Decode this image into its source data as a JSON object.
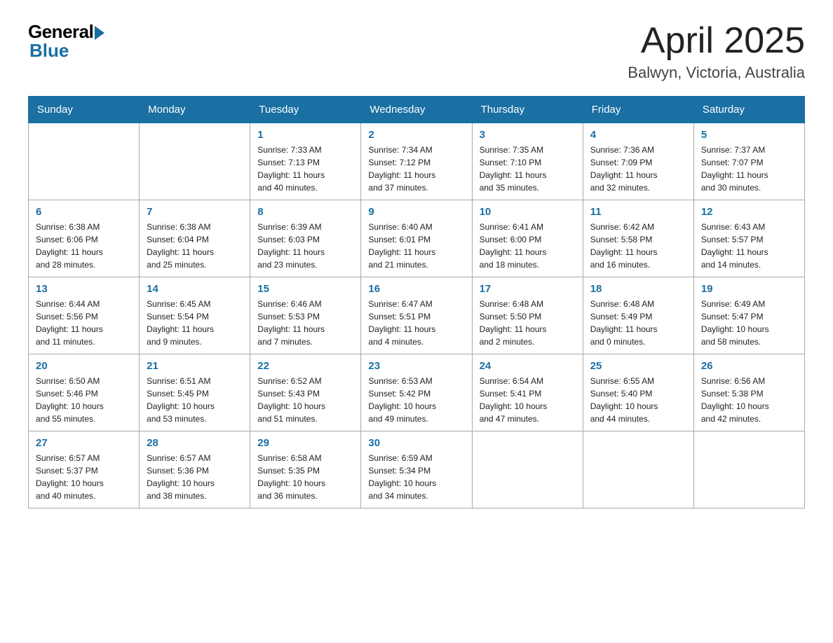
{
  "logo": {
    "general": "General",
    "blue": "Blue"
  },
  "title": "April 2025",
  "subtitle": "Balwyn, Victoria, Australia",
  "days": [
    "Sunday",
    "Monday",
    "Tuesday",
    "Wednesday",
    "Thursday",
    "Friday",
    "Saturday"
  ],
  "weeks": [
    [
      {
        "date": "",
        "info": ""
      },
      {
        "date": "",
        "info": ""
      },
      {
        "date": "1",
        "info": "Sunrise: 7:33 AM\nSunset: 7:13 PM\nDaylight: 11 hours\nand 40 minutes."
      },
      {
        "date": "2",
        "info": "Sunrise: 7:34 AM\nSunset: 7:12 PM\nDaylight: 11 hours\nand 37 minutes."
      },
      {
        "date": "3",
        "info": "Sunrise: 7:35 AM\nSunset: 7:10 PM\nDaylight: 11 hours\nand 35 minutes."
      },
      {
        "date": "4",
        "info": "Sunrise: 7:36 AM\nSunset: 7:09 PM\nDaylight: 11 hours\nand 32 minutes."
      },
      {
        "date": "5",
        "info": "Sunrise: 7:37 AM\nSunset: 7:07 PM\nDaylight: 11 hours\nand 30 minutes."
      }
    ],
    [
      {
        "date": "6",
        "info": "Sunrise: 6:38 AM\nSunset: 6:06 PM\nDaylight: 11 hours\nand 28 minutes."
      },
      {
        "date": "7",
        "info": "Sunrise: 6:38 AM\nSunset: 6:04 PM\nDaylight: 11 hours\nand 25 minutes."
      },
      {
        "date": "8",
        "info": "Sunrise: 6:39 AM\nSunset: 6:03 PM\nDaylight: 11 hours\nand 23 minutes."
      },
      {
        "date": "9",
        "info": "Sunrise: 6:40 AM\nSunset: 6:01 PM\nDaylight: 11 hours\nand 21 minutes."
      },
      {
        "date": "10",
        "info": "Sunrise: 6:41 AM\nSunset: 6:00 PM\nDaylight: 11 hours\nand 18 minutes."
      },
      {
        "date": "11",
        "info": "Sunrise: 6:42 AM\nSunset: 5:58 PM\nDaylight: 11 hours\nand 16 minutes."
      },
      {
        "date": "12",
        "info": "Sunrise: 6:43 AM\nSunset: 5:57 PM\nDaylight: 11 hours\nand 14 minutes."
      }
    ],
    [
      {
        "date": "13",
        "info": "Sunrise: 6:44 AM\nSunset: 5:56 PM\nDaylight: 11 hours\nand 11 minutes."
      },
      {
        "date": "14",
        "info": "Sunrise: 6:45 AM\nSunset: 5:54 PM\nDaylight: 11 hours\nand 9 minutes."
      },
      {
        "date": "15",
        "info": "Sunrise: 6:46 AM\nSunset: 5:53 PM\nDaylight: 11 hours\nand 7 minutes."
      },
      {
        "date": "16",
        "info": "Sunrise: 6:47 AM\nSunset: 5:51 PM\nDaylight: 11 hours\nand 4 minutes."
      },
      {
        "date": "17",
        "info": "Sunrise: 6:48 AM\nSunset: 5:50 PM\nDaylight: 11 hours\nand 2 minutes."
      },
      {
        "date": "18",
        "info": "Sunrise: 6:48 AM\nSunset: 5:49 PM\nDaylight: 11 hours\nand 0 minutes."
      },
      {
        "date": "19",
        "info": "Sunrise: 6:49 AM\nSunset: 5:47 PM\nDaylight: 10 hours\nand 58 minutes."
      }
    ],
    [
      {
        "date": "20",
        "info": "Sunrise: 6:50 AM\nSunset: 5:46 PM\nDaylight: 10 hours\nand 55 minutes."
      },
      {
        "date": "21",
        "info": "Sunrise: 6:51 AM\nSunset: 5:45 PM\nDaylight: 10 hours\nand 53 minutes."
      },
      {
        "date": "22",
        "info": "Sunrise: 6:52 AM\nSunset: 5:43 PM\nDaylight: 10 hours\nand 51 minutes."
      },
      {
        "date": "23",
        "info": "Sunrise: 6:53 AM\nSunset: 5:42 PM\nDaylight: 10 hours\nand 49 minutes."
      },
      {
        "date": "24",
        "info": "Sunrise: 6:54 AM\nSunset: 5:41 PM\nDaylight: 10 hours\nand 47 minutes."
      },
      {
        "date": "25",
        "info": "Sunrise: 6:55 AM\nSunset: 5:40 PM\nDaylight: 10 hours\nand 44 minutes."
      },
      {
        "date": "26",
        "info": "Sunrise: 6:56 AM\nSunset: 5:38 PM\nDaylight: 10 hours\nand 42 minutes."
      }
    ],
    [
      {
        "date": "27",
        "info": "Sunrise: 6:57 AM\nSunset: 5:37 PM\nDaylight: 10 hours\nand 40 minutes."
      },
      {
        "date": "28",
        "info": "Sunrise: 6:57 AM\nSunset: 5:36 PM\nDaylight: 10 hours\nand 38 minutes."
      },
      {
        "date": "29",
        "info": "Sunrise: 6:58 AM\nSunset: 5:35 PM\nDaylight: 10 hours\nand 36 minutes."
      },
      {
        "date": "30",
        "info": "Sunrise: 6:59 AM\nSunset: 5:34 PM\nDaylight: 10 hours\nand 34 minutes."
      },
      {
        "date": "",
        "info": ""
      },
      {
        "date": "",
        "info": ""
      },
      {
        "date": "",
        "info": ""
      }
    ]
  ]
}
